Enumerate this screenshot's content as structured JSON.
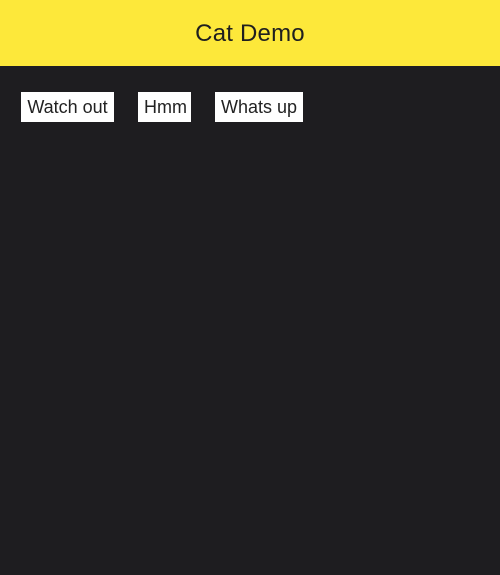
{
  "app_bar": {
    "title": "Cat Demo",
    "background_color": "#fde83a"
  },
  "content": {
    "background_color": "#1e1d20",
    "buttons": [
      {
        "label": "Watch out"
      },
      {
        "label": "Hmm"
      },
      {
        "label": "Whats up"
      }
    ]
  }
}
